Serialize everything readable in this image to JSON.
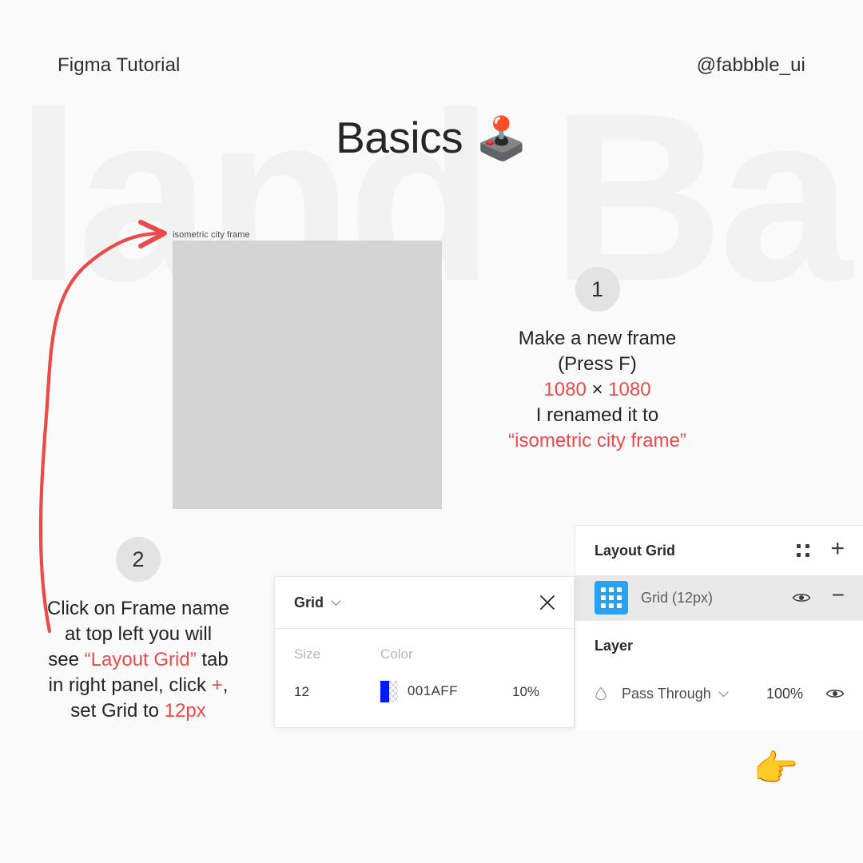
{
  "page": {
    "background_color": "#FAFAFA",
    "accent_red": "#EC4A4A",
    "watermark_text": "land Ba",
    "artboard_color": "#D4D4D4"
  },
  "header": {
    "left_label": "Figma Tutorial",
    "right_handle": "@fabbble_ui"
  },
  "title": {
    "text": "Basics",
    "emoji": "🕹️",
    "emoji_name": "joystick-emoji"
  },
  "canvas": {
    "frame_label": "isometric city frame"
  },
  "steps": [
    {
      "number": "1",
      "lines": [
        [
          {
            "text": "Make a new frame",
            "color": "dark"
          }
        ],
        [
          {
            "text": "(Press F)",
            "color": "dark"
          }
        ],
        [
          {
            "text": "1080",
            "color": "red"
          },
          {
            "text": " × ",
            "color": "dark"
          },
          {
            "text": "1080",
            "color": "red"
          }
        ],
        [
          {
            "text": "I renamed it to",
            "color": "dark"
          }
        ],
        [
          {
            "text": "“isometric city frame”",
            "color": "red"
          }
        ]
      ]
    },
    {
      "number": "2",
      "lines": [
        [
          {
            "text": "Click on Frame name",
            "color": "dark"
          }
        ],
        [
          {
            "text": "at top left you will",
            "color": "dark"
          }
        ],
        [
          {
            "text": "see ",
            "color": "dark"
          },
          {
            "text": "“Layout Grid”",
            "color": "red"
          },
          {
            "text": " tab",
            "color": "dark"
          }
        ],
        [
          {
            "text": "in right panel, click ",
            "color": "dark"
          },
          {
            "text": "+",
            "color": "red"
          },
          {
            "text": ",",
            "color": "dark"
          }
        ],
        [
          {
            "text": "set Grid to ",
            "color": "dark"
          },
          {
            "text": "12px",
            "color": "red"
          }
        ]
      ]
    }
  ],
  "grid_popup": {
    "title": "Grid",
    "caret_icon": "chevron-down-icon",
    "close_icon": "close-icon",
    "labels": {
      "size": "Size",
      "color": "Color"
    },
    "values": {
      "size": "12",
      "color_hex": "001AFF",
      "color_swatch": "#001AFF",
      "opacity": "10%"
    }
  },
  "inspector": {
    "layout_grid": {
      "title": "Layout Grid",
      "settings_icon": "four-dots-icon",
      "add_icon": "plus-icon",
      "row": {
        "icon": "grid-icon",
        "label": "Grid (12px)",
        "visibility_icon": "eye-icon",
        "remove_icon": "minus-icon"
      }
    },
    "layer": {
      "title": "Layer",
      "blend_icon": "blend-mode-icon",
      "blend_mode": "Pass Through",
      "caret_icon": "chevron-down-icon",
      "opacity": "100%",
      "visibility_icon": "eye-icon"
    }
  },
  "pointer": {
    "emoji": "👉",
    "name": "pointing-hand-emoji"
  }
}
